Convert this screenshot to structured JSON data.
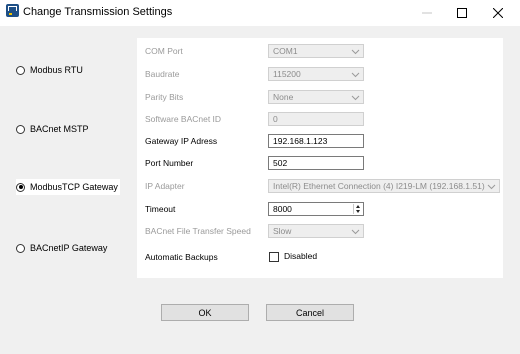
{
  "window": {
    "title": "Change Transmission Settings",
    "icon": "settings-app-icon"
  },
  "protocols": [
    {
      "label": "Modbus RTU",
      "selected": false
    },
    {
      "label": "BACnet MSTP",
      "selected": false
    },
    {
      "label": "ModbusTCP Gateway",
      "selected": true
    },
    {
      "label": "BACnetIP Gateway",
      "selected": false
    }
  ],
  "settings": {
    "com_port": {
      "label": "COM Port",
      "value": "COM1",
      "enabled": false
    },
    "baudrate": {
      "label": "Baudrate",
      "value": "115200",
      "enabled": false
    },
    "parity_bits": {
      "label": "Parity Bits",
      "value": "None",
      "enabled": false
    },
    "software_bacnet_id": {
      "label": "Software BACnet ID",
      "value": "0",
      "enabled": false
    },
    "gateway_ip": {
      "label": "Gateway IP Adress",
      "value": "192.168.1.123",
      "enabled": true
    },
    "port_number": {
      "label": "Port Number",
      "value": "502",
      "enabled": true
    },
    "ip_adapter": {
      "label": "IP Adapter",
      "value": "Intel(R) Ethernet Connection (4) I219-LM  (192.168.1.51)",
      "enabled": false
    },
    "timeout": {
      "label": "Timeout",
      "value": "8000",
      "enabled": true
    },
    "bacnet_transfer_speed": {
      "label": "BACnet File Transfer Speed",
      "value": "Slow",
      "enabled": false
    },
    "automatic_backups": {
      "label": "Automatic Backups",
      "checkbox_label": "Disabled",
      "checked": false
    }
  },
  "buttons": {
    "ok": "OK",
    "cancel": "Cancel"
  }
}
